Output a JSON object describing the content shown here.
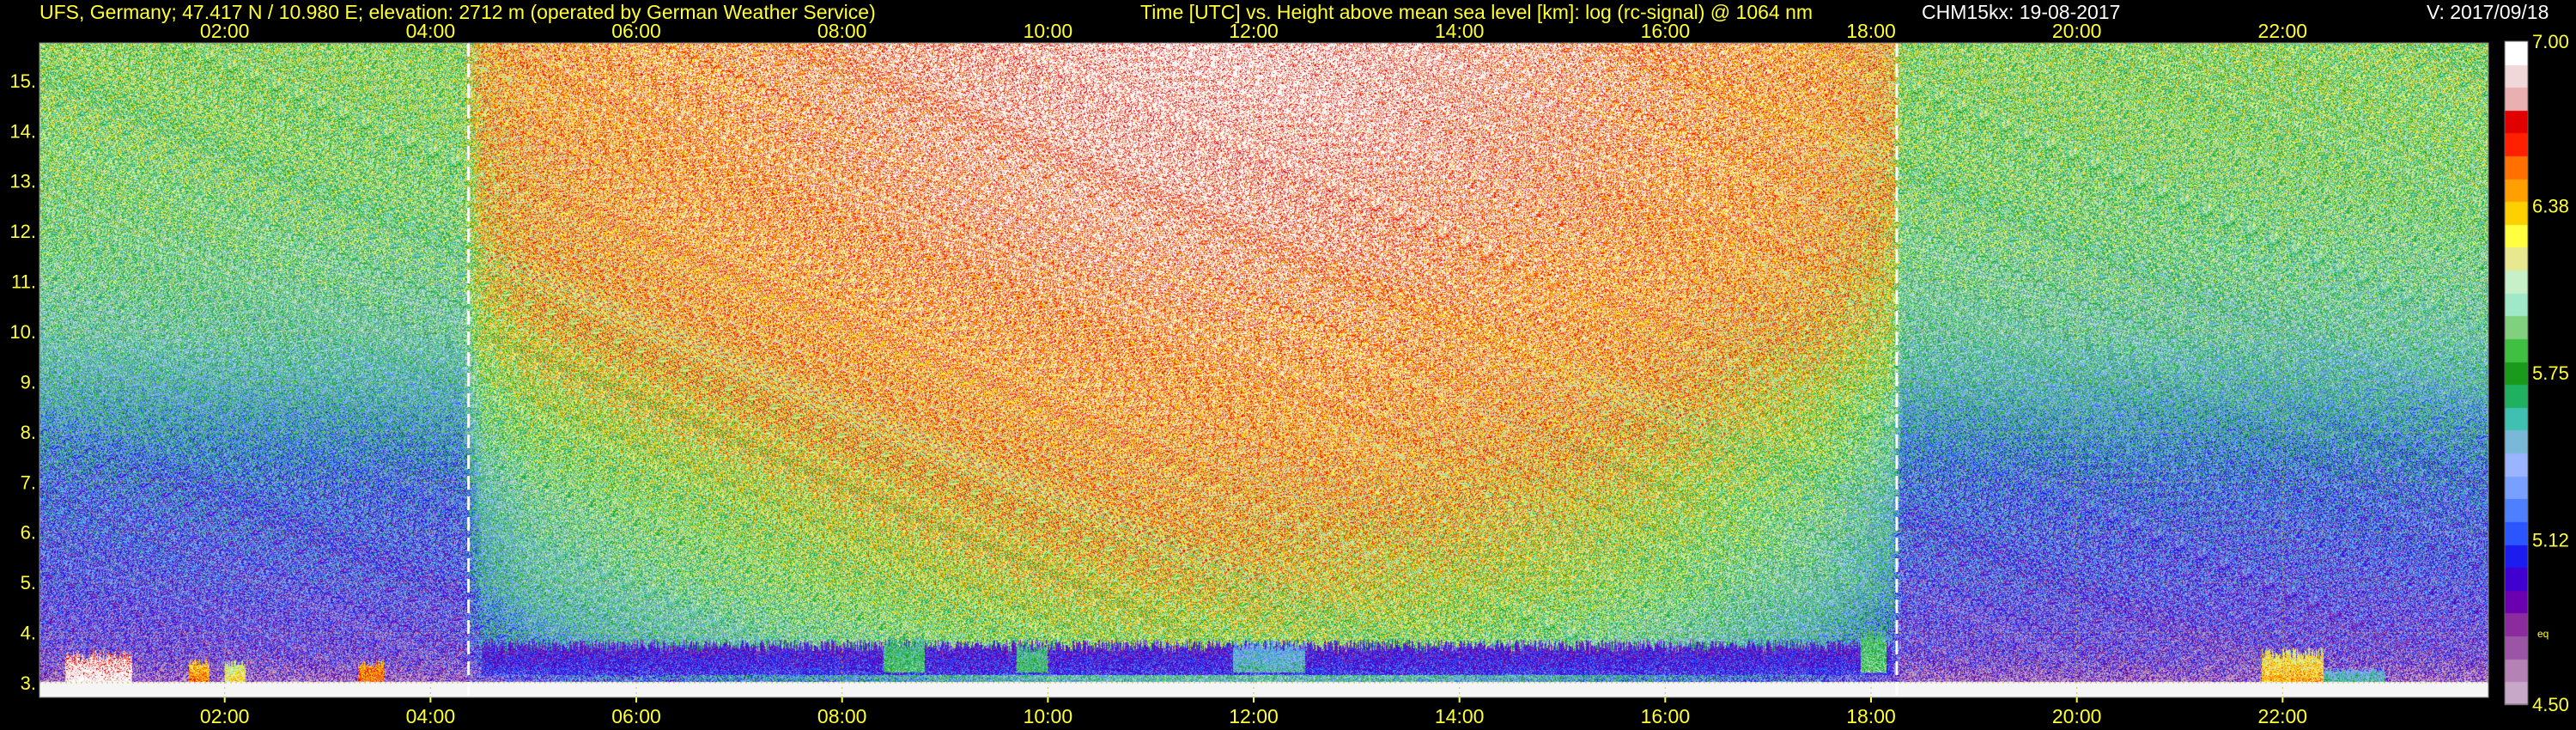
{
  "header": {
    "station": "UFS, Germany; 47.417 N / 10.980 E; elevation: 2712 m  (operated by German Weather Service)",
    "plot_title": "Time [UTC] vs. Height above mean sea level [km]: log (rc-signal) @ 1064 nm",
    "instrument_date": "CHM15kx: 19-08-2017",
    "version": "V: 2017/09/18"
  },
  "colors": {
    "background": "#000000",
    "title_text": "#ffff33",
    "grid": "#b4b43c",
    "marker_line": "#ffffff",
    "ground": "#f5f5f5"
  },
  "chart_data": {
    "type": "heatmap",
    "variable": "log (rc-signal) @ 1064 nm",
    "x": {
      "unit": "UTC hour",
      "range": [
        0.2,
        24.0
      ],
      "ticks": [
        2,
        4,
        6,
        8,
        10,
        12,
        14,
        16,
        18,
        20,
        22
      ],
      "tick_labels": [
        "02:00",
        "04:00",
        "06:00",
        "08:00",
        "10:00",
        "12:00",
        "14:00",
        "16:00",
        "18:00",
        "20:00",
        "22:00"
      ],
      "label_position": "top and bottom"
    },
    "y": {
      "unit": "km above mean sea level",
      "range": [
        2.71,
        15.75
      ],
      "ticks": [
        3,
        4,
        5,
        6,
        7,
        8,
        9,
        10,
        11,
        12,
        13,
        14,
        15
      ],
      "tick_labels": [
        "3.",
        "4.",
        "5.",
        "6.",
        "7.",
        "8.",
        "9.",
        "10.",
        "11.",
        "12.",
        "13.",
        "14.",
        "15."
      ]
    },
    "grid": true,
    "colorbar": {
      "range": [
        4.5,
        7.0
      ],
      "tick_values": [
        4.5,
        5.12,
        5.75,
        6.38,
        7.0
      ],
      "tick_labels": [
        "4.50",
        "5.12",
        "5.75",
        "6.38",
        "7.00"
      ],
      "extra_label": "eq",
      "placement": "right",
      "colors": [
        "#c8a8c8",
        "#b482b4",
        "#9b55a6",
        "#8a2b9e",
        "#6a00b0",
        "#4000d0",
        "#1c1cf0",
        "#2a55ff",
        "#4d7fff",
        "#7aa0ff",
        "#9bb4ff",
        "#7ab8d8",
        "#40c0b0",
        "#1fb060",
        "#1a9a1a",
        "#40c040",
        "#80d080",
        "#a0e8c8",
        "#c8f0c8",
        "#e8e890",
        "#ffff40",
        "#ffd000",
        "#ffa000",
        "#ff7000",
        "#ff2000",
        "#e00000",
        "#e8b0b0",
        "#f0d8d8",
        "#ffffff"
      ]
    },
    "marker_lines": {
      "description": "sunrise / sunset",
      "times": [
        4.37,
        18.25
      ],
      "labels": [
        "",
        ""
      ]
    },
    "background_intensity": {
      "description": "log(rc-signal) of clear-air/noise background vs hour and height",
      "hours": [
        0.2,
        1,
        2,
        3,
        4,
        4.3,
        4.5,
        5,
        6,
        7,
        8,
        9,
        10,
        11,
        12,
        13,
        14,
        15,
        16,
        17,
        17.5,
        18,
        18.2,
        18.3,
        19,
        20,
        21,
        22,
        23,
        24
      ],
      "heights_km": [
        3.0,
        3.5,
        4.0,
        5.0,
        6.0,
        7.0,
        8.0,
        9.0,
        10.0,
        11.0,
        12.0,
        13.0,
        14.0,
        15.0,
        15.75
      ],
      "night_profile": [
        4.6,
        4.85,
        5.0,
        5.15,
        5.22,
        5.3,
        5.45,
        5.6,
        5.75,
        5.82,
        5.88,
        5.92,
        5.95,
        5.97,
        5.98
      ],
      "day_peak_profile": [
        5.6,
        5.9,
        6.05,
        6.2,
        6.3,
        6.4,
        6.5,
        6.6,
        6.7,
        6.8,
        6.88,
        6.93,
        6.97,
        7.0,
        7.0
      ],
      "day_weight": [
        0,
        0,
        0,
        0,
        0,
        0,
        0.35,
        0.5,
        0.62,
        0.72,
        0.82,
        0.9,
        0.96,
        1.0,
        1.0,
        0.98,
        0.93,
        0.86,
        0.76,
        0.62,
        0.55,
        0.42,
        0.35,
        0,
        0,
        0,
        0,
        0,
        0,
        0
      ]
    },
    "boundary_layer_features": [
      {
        "start_h": 0.45,
        "end_h": 1.1,
        "bottom_km": 3.0,
        "top_km": 3.65,
        "value": 7.0,
        "kind": "low cloud"
      },
      {
        "start_h": 1.65,
        "end_h": 1.85,
        "bottom_km": 3.0,
        "top_km": 3.5,
        "value": 6.5,
        "kind": "low cloud"
      },
      {
        "start_h": 2.0,
        "end_h": 2.2,
        "bottom_km": 3.0,
        "top_km": 3.45,
        "value": 6.3,
        "kind": "low cloud"
      },
      {
        "start_h": 3.3,
        "end_h": 3.55,
        "bottom_km": 3.0,
        "top_km": 3.45,
        "value": 6.6,
        "kind": "low cloud"
      },
      {
        "start_h": 4.5,
        "end_h": 18.2,
        "bottom_km": 3.15,
        "top_km": 3.85,
        "value": 5.1,
        "kind": "aerosol layer"
      },
      {
        "start_h": 8.4,
        "end_h": 8.8,
        "bottom_km": 3.2,
        "top_km": 3.95,
        "value": 5.8,
        "kind": "aerosol"
      },
      {
        "start_h": 9.7,
        "end_h": 10.0,
        "bottom_km": 3.2,
        "top_km": 3.8,
        "value": 5.75,
        "kind": "aerosol"
      },
      {
        "start_h": 11.8,
        "end_h": 12.5,
        "bottom_km": 3.2,
        "top_km": 3.85,
        "value": 5.55,
        "kind": "aerosol"
      },
      {
        "start_h": 17.9,
        "end_h": 18.15,
        "bottom_km": 3.2,
        "top_km": 4.1,
        "value": 5.9,
        "kind": "aerosol"
      },
      {
        "start_h": 21.8,
        "end_h": 22.4,
        "bottom_km": 3.0,
        "top_km": 3.7,
        "value": 6.4,
        "kind": "low cloud"
      },
      {
        "start_h": 22.4,
        "end_h": 23.0,
        "bottom_km": 3.0,
        "top_km": 3.3,
        "value": 5.6,
        "kind": "residual layer"
      }
    ]
  }
}
